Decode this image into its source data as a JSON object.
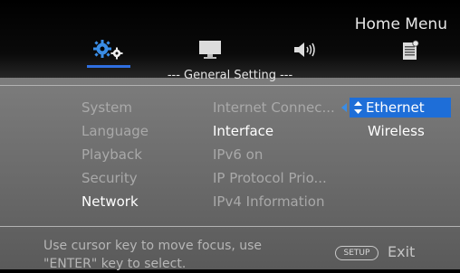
{
  "header": {
    "title": "Home Menu",
    "tabs": [
      {
        "icon": "settings-gear-icon",
        "selected": true
      },
      {
        "icon": "monitor-icon",
        "selected": false
      },
      {
        "icon": "speaker-icon",
        "selected": false
      },
      {
        "icon": "info-document-icon",
        "selected": false
      }
    ],
    "section_title": "--- General Setting ---"
  },
  "categories": [
    "System",
    "Language",
    "Playback",
    "Security",
    "Network"
  ],
  "active_category": "Network",
  "network_items": [
    "Internet Connec...",
    "Interface",
    "IPv6 on",
    "IP Protocol Prio...",
    "IPv4 Information"
  ],
  "active_item": "Interface",
  "options": [
    "Ethernet",
    "Wireless"
  ],
  "selected_option": "Ethernet",
  "footer": {
    "hint": "Use cursor key to move focus, use \"ENTER\" key to select.",
    "setup_label": "SETUP",
    "exit_label": "Exit"
  },
  "colors": {
    "accent": "#1e6ed8",
    "background": "#7a7a7a"
  }
}
